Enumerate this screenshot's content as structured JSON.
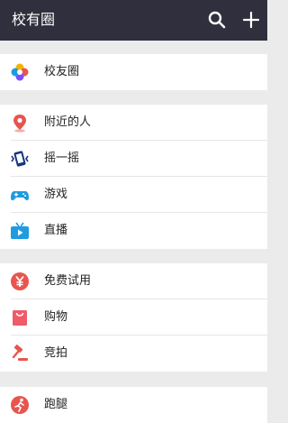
{
  "app": {
    "title": "校有圈"
  },
  "header": {
    "search_icon": "search-icon",
    "add_icon": "plus-icon"
  },
  "groups": [
    {
      "items": [
        {
          "label": "校友圈",
          "icon": "flower-icon"
        }
      ]
    },
    {
      "items": [
        {
          "label": "附近的人",
          "icon": "location-pin-icon"
        },
        {
          "label": "摇一摇",
          "icon": "phone-shake-icon"
        },
        {
          "label": "游戏",
          "icon": "gamepad-icon"
        },
        {
          "label": "直播",
          "icon": "tv-icon"
        }
      ]
    },
    {
      "items": [
        {
          "label": "免费试用",
          "icon": "yen-icon"
        },
        {
          "label": "购物",
          "icon": "shopping-bag-icon"
        },
        {
          "label": "竞拍",
          "icon": "gavel-icon"
        }
      ]
    },
    {
      "items": [
        {
          "label": "跑腿",
          "icon": "runner-icon"
        }
      ]
    }
  ],
  "colors": {
    "header_bg": "#2f2f3d",
    "page_bg": "#ebebeb",
    "item_bg": "#ffffff",
    "accent_red": "#e8554e",
    "accent_blue": "#1f9be0",
    "accent_navy": "#17357e"
  }
}
